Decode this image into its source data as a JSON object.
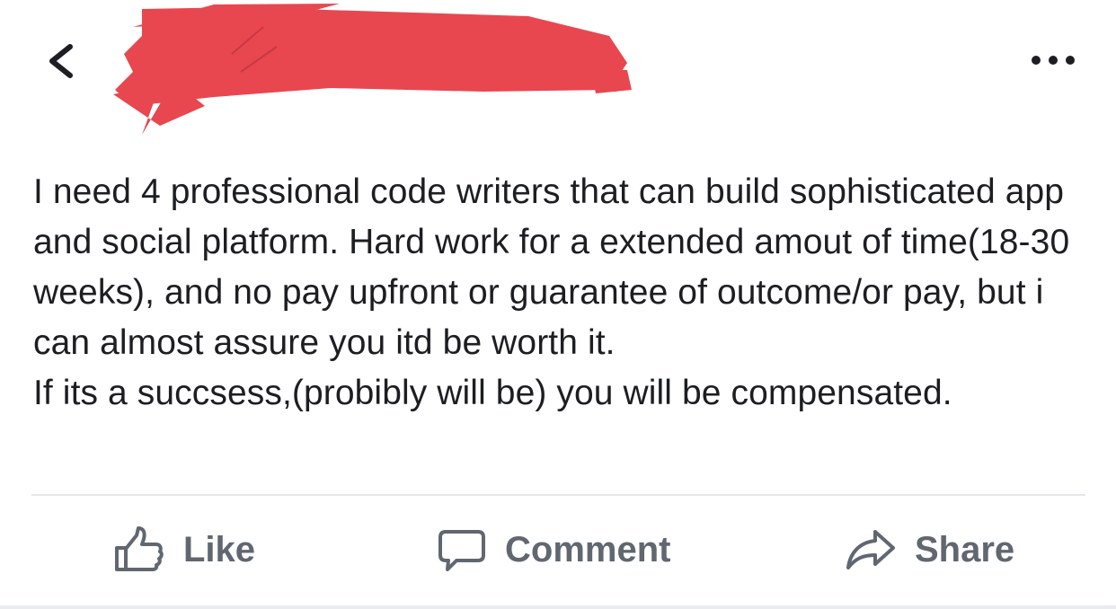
{
  "header": {
    "back_icon": "chevron-left-icon",
    "redacted_name": "",
    "more_icon": "more-horizontal-icon"
  },
  "post": {
    "paragraphs": [
      "I need 4 professional code writers that can build sophisticated app and social platform. Hard work for a extended amout of time(18-30 weeks), and no pay upfront or guarantee of outcome/or pay, but i can almost assure you itd be worth it.",
      "If its a succsess,(probibly will be) you will be compensated."
    ]
  },
  "actions": {
    "like_label": "Like",
    "comment_label": "Comment",
    "share_label": "Share",
    "like_icon": "thumbs-up-icon",
    "comment_icon": "speech-bubble-icon",
    "share_icon": "share-arrow-icon"
  },
  "colors": {
    "redaction": "#e8474f",
    "action_text": "#606770",
    "body_text": "#1c1e21",
    "divider": "#e4e6ea"
  }
}
